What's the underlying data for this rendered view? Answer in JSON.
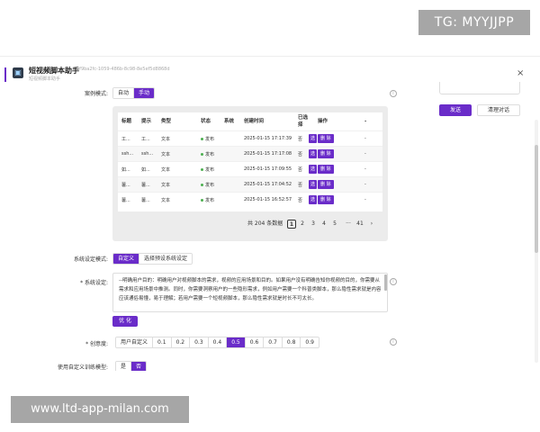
{
  "watermark_top": "TG: MYYJJPP",
  "watermark_bottom": "www.ltd-app-milan.com",
  "app": {
    "title": "短视频脚本助手",
    "id": "0f9ba2fc-1059-486b-8c98-8e5ef5d8868d",
    "subtitle": "短视频脚本助手",
    "close": "×"
  },
  "right_panel": {
    "send_label": "发送",
    "clear_label": "清理对话"
  },
  "case_mode": {
    "label": "案例模式:",
    "options": [
      "自动",
      "手动"
    ],
    "selected": "手动"
  },
  "table": {
    "headers": [
      "标题",
      "提示",
      "类型",
      "状态",
      "系统",
      "创建时间",
      "已选择",
      "操作",
      "-"
    ],
    "rows": [
      {
        "title": "工...",
        "prompt": "工...",
        "type": "文本",
        "status": "发布",
        "system": "",
        "created": "2025-01-15 17:17:39",
        "selected": "否",
        "actions": [
          "选",
          "删",
          "除"
        ],
        "extra": "-"
      },
      {
        "title": "ssh...",
        "prompt": "ssh...",
        "type": "文本",
        "status": "发布",
        "system": "",
        "created": "2025-01-15 17:17:08",
        "selected": "否",
        "actions": [
          "选",
          "删",
          "除"
        ],
        "extra": "-"
      },
      {
        "title": "如...",
        "prompt": "如...",
        "type": "文本",
        "status": "发布",
        "system": "",
        "created": "2025-01-15 17:09:55",
        "selected": "否",
        "actions": [
          "选",
          "删",
          "除"
        ],
        "extra": "-"
      },
      {
        "title": "薯...",
        "prompt": "薯...",
        "type": "文本",
        "status": "发布",
        "system": "",
        "created": "2025-01-15 17:04:52",
        "selected": "否",
        "actions": [
          "选",
          "删",
          "除"
        ],
        "extra": "-"
      },
      {
        "title": "薯...",
        "prompt": "薯...",
        "type": "文本",
        "status": "发布",
        "system": "",
        "created": "2025-01-15 16:52:57",
        "selected": "否",
        "actions": [
          "选",
          "删",
          "除"
        ],
        "extra": "-"
      }
    ],
    "pagination": {
      "total_label": "共 204 条数据",
      "pages": [
        "1",
        "2",
        "3",
        "4",
        "5",
        "···",
        "41"
      ],
      "current": "1",
      "next": "›"
    }
  },
  "system_mode": {
    "label": "系统设定模式:",
    "options": [
      "自定义",
      "选择预设系统设定"
    ],
    "selected": "自定义"
  },
  "system_setting": {
    "label": "* 系统设定:",
    "text": "--明确用户目的：明确用户对视频脚本的需求，视频的应用场景和目的。如果用户没有明确告知你视频的目的，你需要从需求和应用场景中推测。同时，你需要洞察用户的一些隐形需求，例如用户需要一个科普类脚本，那么隐性需求就是内容应该通俗易懂，易于理解；若用户需要一个短视频脚本，那么隐性需求就是时长不可太长。",
    "optimize_label": "优 化"
  },
  "creativity": {
    "label": "* 创意度:",
    "options": [
      "用户自定义",
      "0.1",
      "0.2",
      "0.3",
      "0.4",
      "0.5",
      "0.6",
      "0.7",
      "0.8",
      "0.9"
    ],
    "selected": "0.5"
  },
  "custom_model": {
    "label": "使用自定义训练模型:",
    "options": [
      "是",
      "否"
    ],
    "selected": "否"
  },
  "info_icon": "i"
}
